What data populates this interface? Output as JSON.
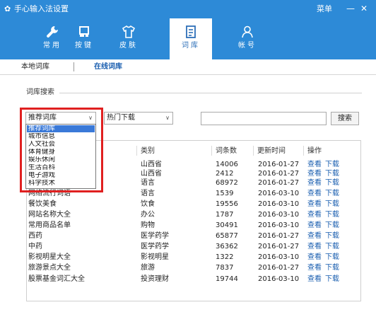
{
  "titlebar": {
    "title": "手心输入法设置",
    "menu_label": "菜单",
    "minimize_glyph": "—",
    "close_glyph": "✕"
  },
  "tabs": [
    {
      "label": "常用",
      "icon": "wrench-icon"
    },
    {
      "label": "按键",
      "icon": "keyboard-icon"
    },
    {
      "label": "皮肤",
      "icon": "tshirt-icon"
    },
    {
      "label": "词库",
      "icon": "document-icon"
    },
    {
      "label": "帐号",
      "icon": "user-icon"
    }
  ],
  "active_tab": "词库",
  "subnav": {
    "local_label": "本地词库",
    "online_label": "在线词库"
  },
  "search_section": {
    "title": "词库搜索",
    "category_select": {
      "value": "推荐词库",
      "options": [
        "推荐词库",
        "城市信息",
        "人文社会",
        "体育健身",
        "娱乐休闲",
        "生活百科",
        "电子游戏",
        "科学技术"
      ]
    },
    "sort_select": {
      "value": "热门下载"
    },
    "search_input_value": "",
    "search_button_label": "搜索"
  },
  "table": {
    "headers": [
      "类别",
      "词条数",
      "更新时间",
      "操作"
    ],
    "rows": [
      {
        "name": "",
        "category": "山西省",
        "count": "14006",
        "date": "2016-01-27",
        "view": "查看",
        "download": "下载"
      },
      {
        "name": "",
        "category": "山西省",
        "count": "2412",
        "date": "2016-01-27",
        "view": "查看",
        "download": "下载"
      },
      {
        "name": "",
        "category": "语言",
        "count": "68972",
        "date": "2016-01-27",
        "view": "查看",
        "download": "下载"
      },
      {
        "name": "网络流行词语",
        "category": "语言",
        "count": "1539",
        "date": "2016-03-10",
        "view": "查看",
        "download": "下载"
      },
      {
        "name": "餐饮美食",
        "category": "饮食",
        "count": "19556",
        "date": "2016-03-10",
        "view": "查看",
        "download": "下载"
      },
      {
        "name": "网站名称大全",
        "category": "办公",
        "count": "1787",
        "date": "2016-03-10",
        "view": "查看",
        "download": "下载"
      },
      {
        "name": "常用商品名单",
        "category": "购物",
        "count": "30491",
        "date": "2016-03-10",
        "view": "查看",
        "download": "下载"
      },
      {
        "name": "西药",
        "category": "医学药学",
        "count": "65877",
        "date": "2016-01-27",
        "view": "查看",
        "download": "下载"
      },
      {
        "name": "中药",
        "category": "医学药学",
        "count": "36362",
        "date": "2016-01-27",
        "view": "查看",
        "download": "下载"
      },
      {
        "name": "影视明星大全",
        "category": "影视明星",
        "count": "1322",
        "date": "2016-03-10",
        "view": "查看",
        "download": "下载"
      },
      {
        "name": "旅游景点大全",
        "category": "旅游",
        "count": "7837",
        "date": "2016-01-27",
        "view": "查看",
        "download": "下载"
      },
      {
        "name": "股票基金词汇大全",
        "category": "投资理财",
        "count": "19744",
        "date": "2016-03-10",
        "view": "查看",
        "download": "下载"
      }
    ]
  },
  "colors": {
    "header_blue": "#2d8ad7",
    "link_blue": "#1b5fb0",
    "selected_blue": "#3a79d8",
    "highlight_red": "#e02020"
  }
}
